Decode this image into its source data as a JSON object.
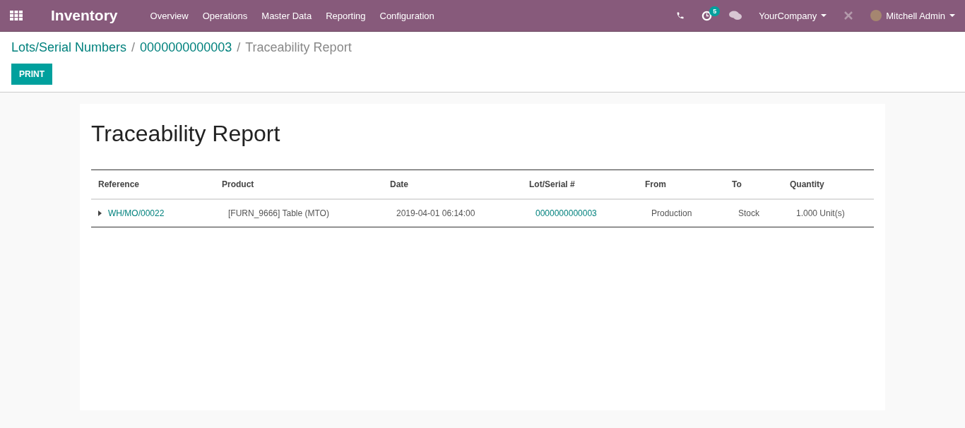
{
  "navbar": {
    "app_title": "Inventory",
    "menu": [
      "Overview",
      "Operations",
      "Master Data",
      "Reporting",
      "Configuration"
    ],
    "activity_count": "5",
    "company": "YourCompany",
    "user": "Mitchell Admin"
  },
  "breadcrumb": [
    {
      "label": "Lots/Serial Numbers",
      "link": true
    },
    {
      "separator": "/",
      "label": "0000000000003",
      "link": true
    },
    {
      "separator": "/",
      "label": "Traceability Report",
      "link": false
    }
  ],
  "buttons": [
    "PRINT"
  ],
  "report": {
    "title": "Traceability Report",
    "columns": [
      "Reference",
      "Product",
      "Date",
      "Lot/Serial #",
      "From",
      "To",
      "Quantity"
    ],
    "rows": [
      {
        "expanded": false,
        "reference": "WH/MO/00022",
        "product": "[FURN_9666] Table (MTO)",
        "date": "2019-04-01 06:14:00",
        "lot": "0000000000003",
        "from": "Production",
        "to": "Stock",
        "quantity": "1.000 Unit(s)"
      }
    ]
  }
}
